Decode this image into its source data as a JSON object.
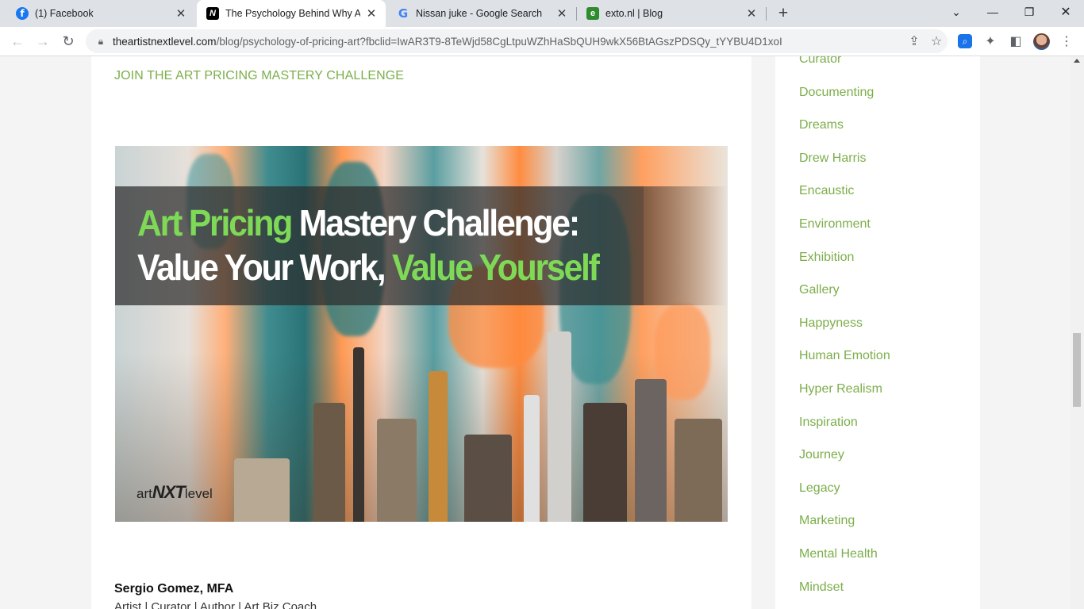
{
  "browser": {
    "tabs": [
      {
        "title": "(1) Facebook",
        "favicon": "facebook-icon",
        "favicon_glyph": "f"
      },
      {
        "title": "The Psychology Behind Why Arti",
        "favicon": "artnxtlevel-icon",
        "favicon_glyph": "N"
      },
      {
        "title": "Nissan juke - Google Search",
        "favicon": "google-icon",
        "favicon_glyph": "G"
      },
      {
        "title": "exto.nl | Blog",
        "favicon": "exto-icon",
        "favicon_glyph": "e"
      }
    ],
    "active_tab_index": 1,
    "url_host": "theartistnextlevel.com",
    "url_path": "/blog/psychology-of-pricing-art?fbclid=IwAR3T9-8TeWjd58CgLtpuWZhHaSbQUH9wkX56BtAGszPDSQy_tYYBU4D1xoI"
  },
  "article": {
    "challenge_link": "JOIN THE ART PRICING MASTERY CHALLENGE",
    "hero": {
      "line1_green": "Art Pricing",
      "line1_white": " Mastery Challenge:",
      "line2_white": "Value Your Work, ",
      "line2_green": "Value Yourself",
      "logo_prefix": "art",
      "logo_bold": "NXT",
      "logo_suffix": "level"
    },
    "author_name": "Sergio Gomez, MFA",
    "author_subtitle": "Artist | Curator | Author | Art Biz Coach"
  },
  "sidebar": {
    "categories": [
      "Curator",
      "Documenting",
      "Dreams",
      "Drew Harris",
      "Encaustic",
      "Environment",
      "Exhibition",
      "Gallery",
      "Happyness",
      "Human Emotion",
      "Hyper Realism",
      "Inspiration",
      "Journey",
      "Legacy",
      "Marketing",
      "Mental Health",
      "Mindset"
    ]
  },
  "colors": {
    "link_green": "#7cae4a",
    "hero_green": "#7ed957",
    "tabstrip_bg": "#dee1e6"
  }
}
